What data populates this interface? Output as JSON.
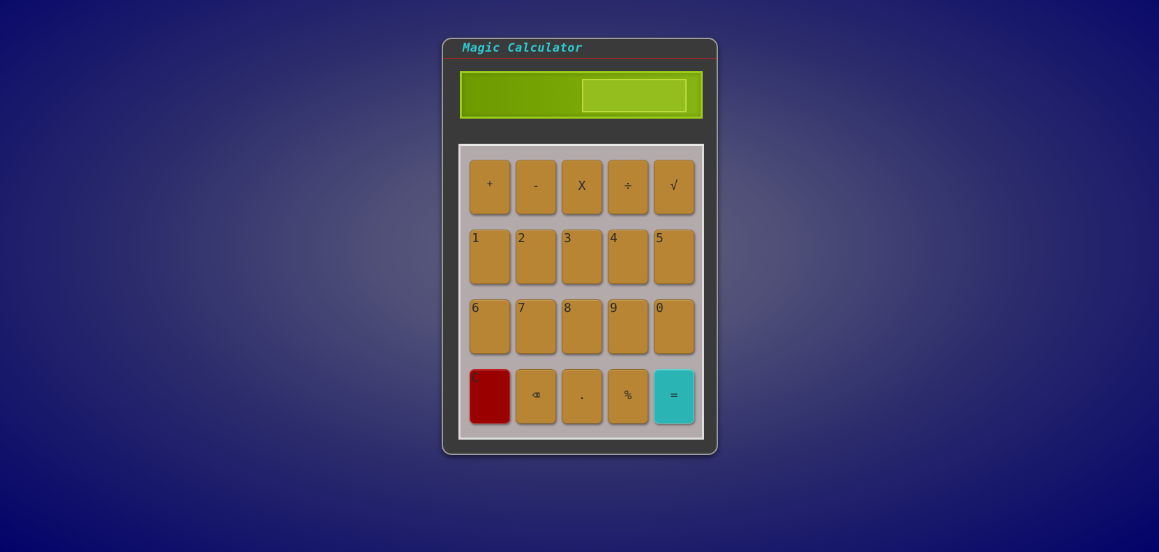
{
  "app": {
    "title": "Magic Calculator"
  },
  "display": {
    "value": ""
  },
  "keys": {
    "row1": [
      "+",
      "-",
      "X",
      "÷",
      "√"
    ],
    "row2": [
      "1",
      "2",
      "3",
      "4",
      "5"
    ],
    "row3": [
      "6",
      "7",
      "8",
      "9",
      "0"
    ],
    "row4": [
      "C",
      "⌫",
      ".",
      "%",
      "="
    ]
  },
  "colors": {
    "key": "#b88534",
    "clear_key": "#9b0000",
    "equals_key": "#2ab4b4",
    "display": "#7aa806",
    "title": "#2ec8d0"
  }
}
